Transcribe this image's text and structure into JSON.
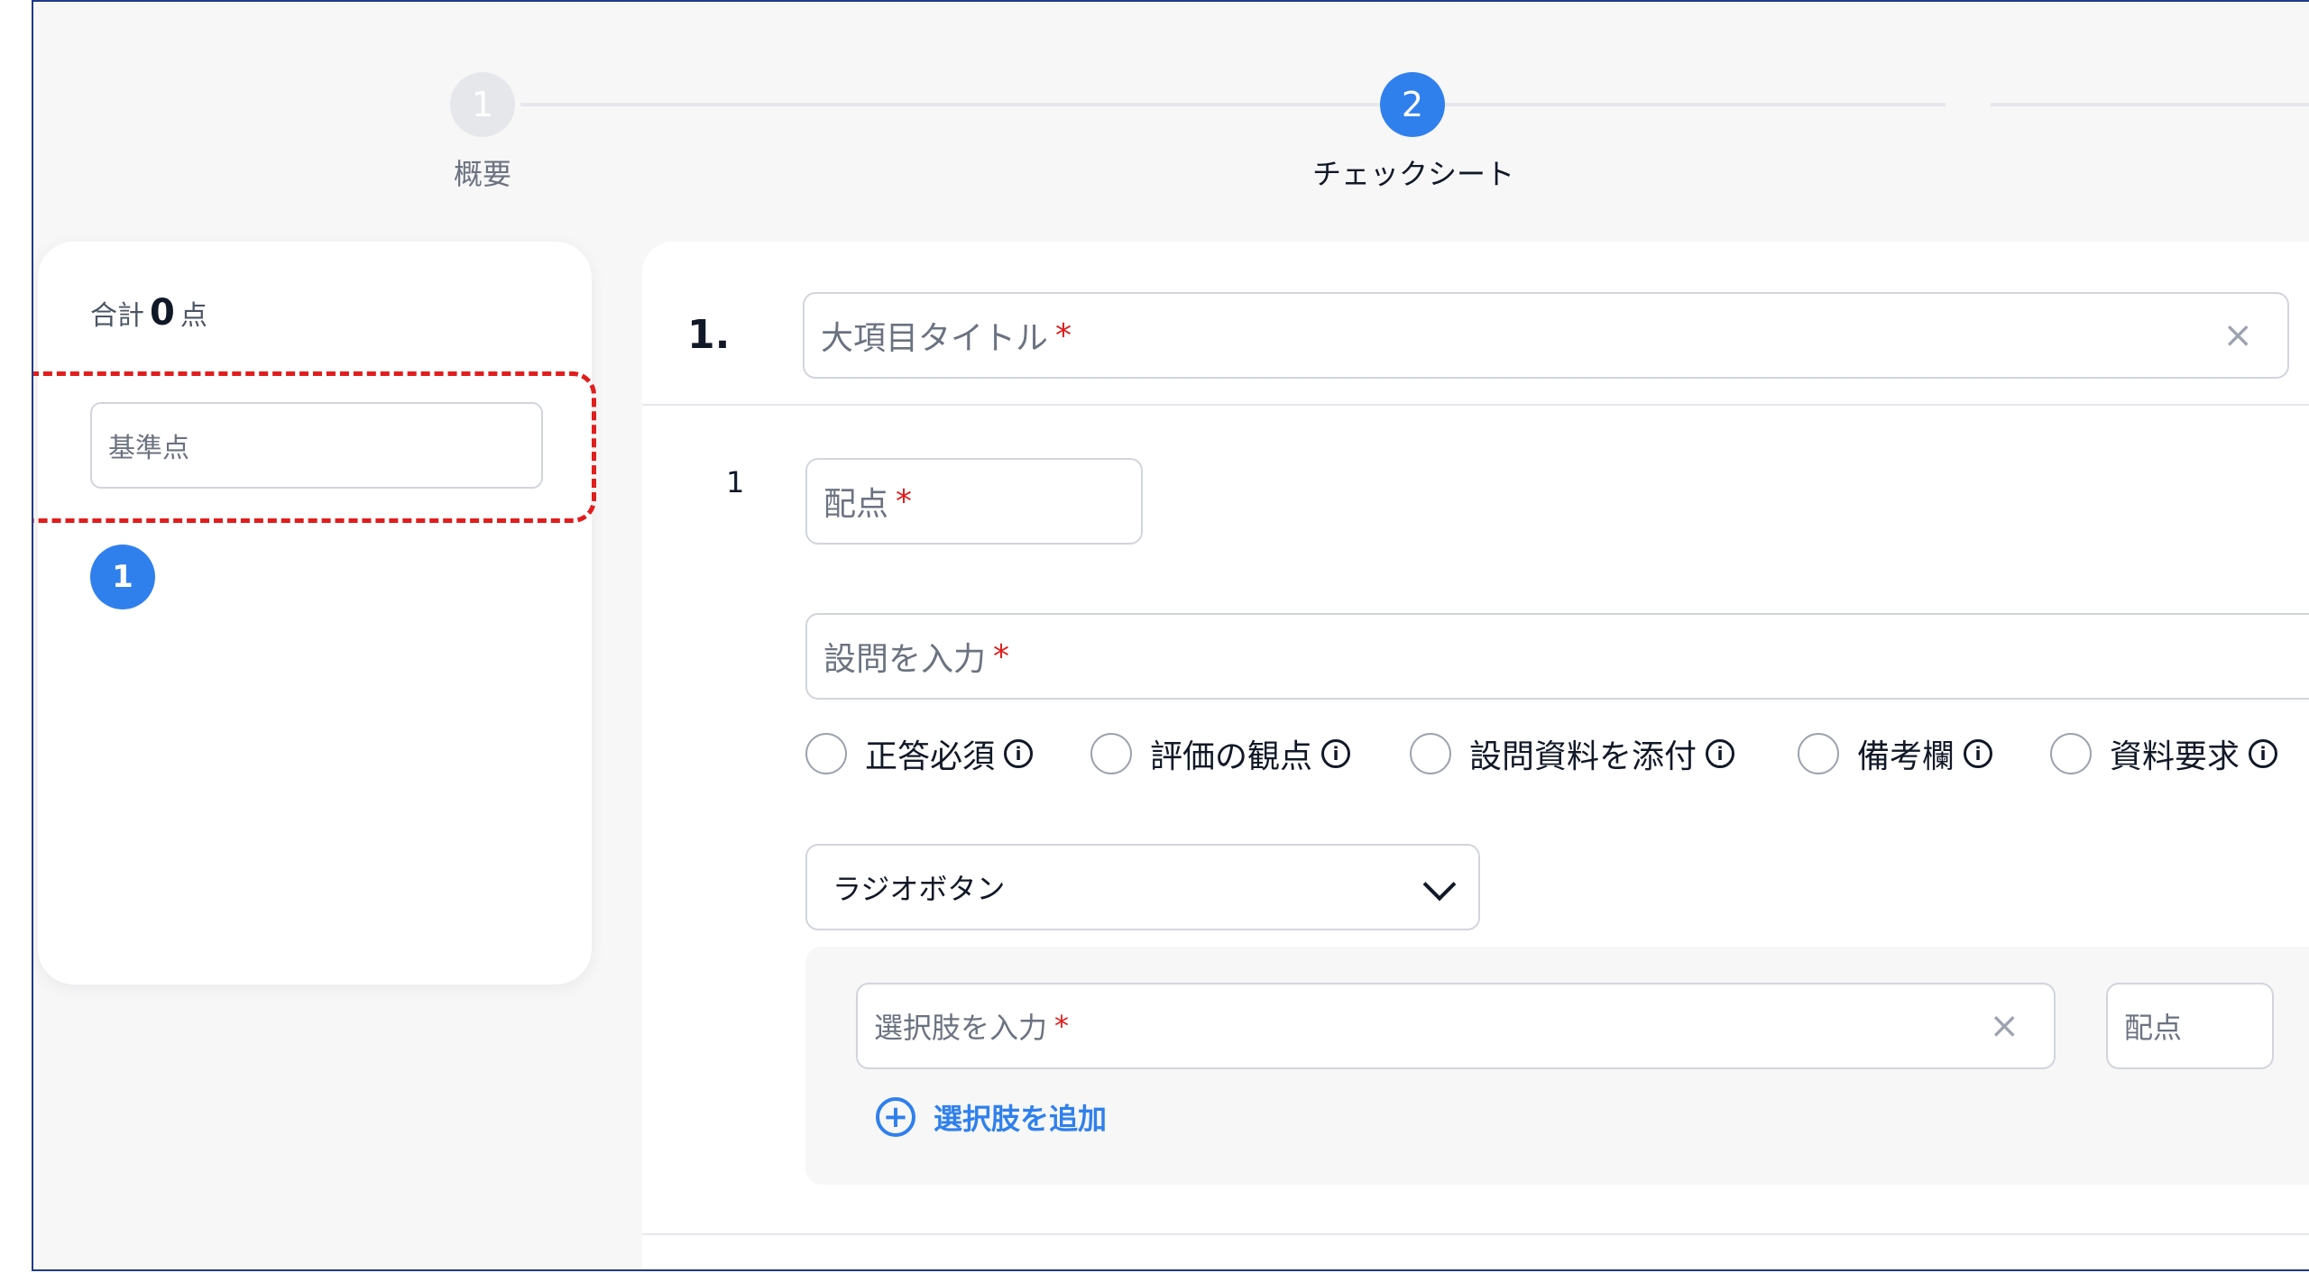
{
  "stepper": {
    "steps": [
      {
        "number": "1",
        "label": "概要"
      },
      {
        "number": "2",
        "label": "チェックシート"
      }
    ]
  },
  "summary": {
    "total_prefix": "合計",
    "total_value": "0",
    "total_suffix": "点",
    "base_score_placeholder": "基準点",
    "section_badge": "1"
  },
  "section": {
    "number": "1.",
    "title_placeholder": "大項目タイトル",
    "required_mark": "*",
    "clear_symbol": "×"
  },
  "question": {
    "number": "1",
    "score_placeholder": "配点",
    "question_placeholder": "設問を入力",
    "options": [
      {
        "label": "正答必須",
        "info": "i"
      },
      {
        "label": "評価の観点",
        "info": "i"
      },
      {
        "label": "設問資料を添付",
        "info": "i"
      },
      {
        "label": "備考欄",
        "info": "i"
      },
      {
        "label": "資料要求",
        "info": "i"
      }
    ],
    "answer_type": "ラジオボタン",
    "choice_placeholder": "選択肢を入力",
    "choice_score_placeholder": "配点",
    "add_choice_label": "選択肢を追加",
    "add_symbol": "+"
  },
  "colors": {
    "accent": "#2f80ed",
    "required": "#e11d1d",
    "highlight_border": "#e11d1d"
  }
}
